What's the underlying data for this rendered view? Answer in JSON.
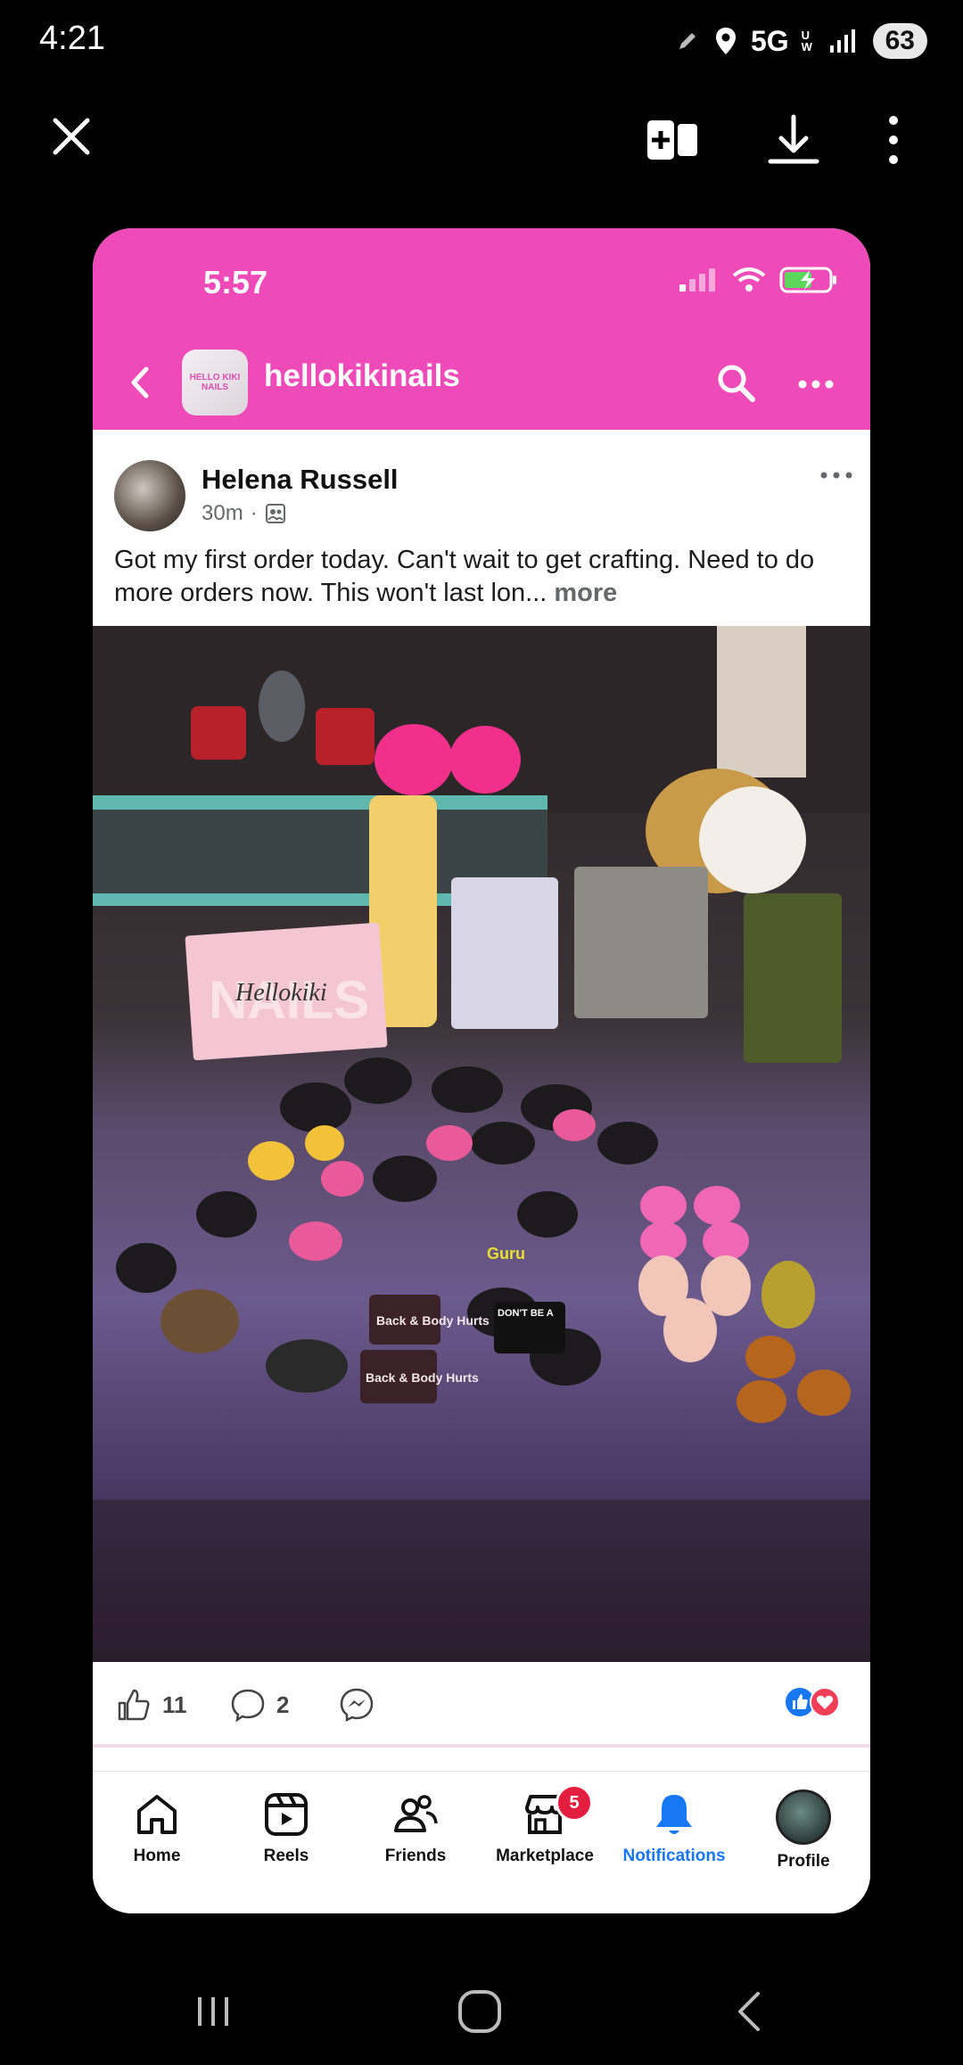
{
  "status_bar": {
    "time": "4:21",
    "network": "5G",
    "network_sub": "UW",
    "battery": "63"
  },
  "viewer_toolbar": {
    "close_icon": "close-icon",
    "buttons": [
      "add-to-collage-icon",
      "download-icon",
      "more-vertical-icon"
    ]
  },
  "inner_status": {
    "time": "5:57"
  },
  "page_header": {
    "name": "hellokikinails",
    "avatar_text": "HELLO KIKI NAILS"
  },
  "post": {
    "author": "Helena Russell",
    "time": "30m",
    "text": "Got my first order today.  Can't wait to get crafting. Need to do more orders now. This won't last lon...",
    "more_label": "more",
    "photo_card_script": "Hellokiki",
    "photo_card_bg_text": "NAILS",
    "photo_labels": [
      "Back & Body Hurts",
      "Back & Body Hurts",
      "DON'T BE A",
      "Guru"
    ]
  },
  "actions": {
    "likes": "11",
    "comments": "2"
  },
  "bottom_nav": [
    {
      "label": "Home",
      "icon": "home-icon"
    },
    {
      "label": "Reels",
      "icon": "reels-icon"
    },
    {
      "label": "Friends",
      "icon": "friends-icon"
    },
    {
      "label": "Marketplace",
      "icon": "marketplace-icon",
      "badge": "5"
    },
    {
      "label": "Notifications",
      "icon": "bell-icon",
      "active": true
    },
    {
      "label": "Profile",
      "icon": "profile-avatar"
    }
  ],
  "colors": {
    "header_pink": "#ee4bb8",
    "facebook_blue": "#1877f2",
    "badge_red": "#e41e3f"
  }
}
